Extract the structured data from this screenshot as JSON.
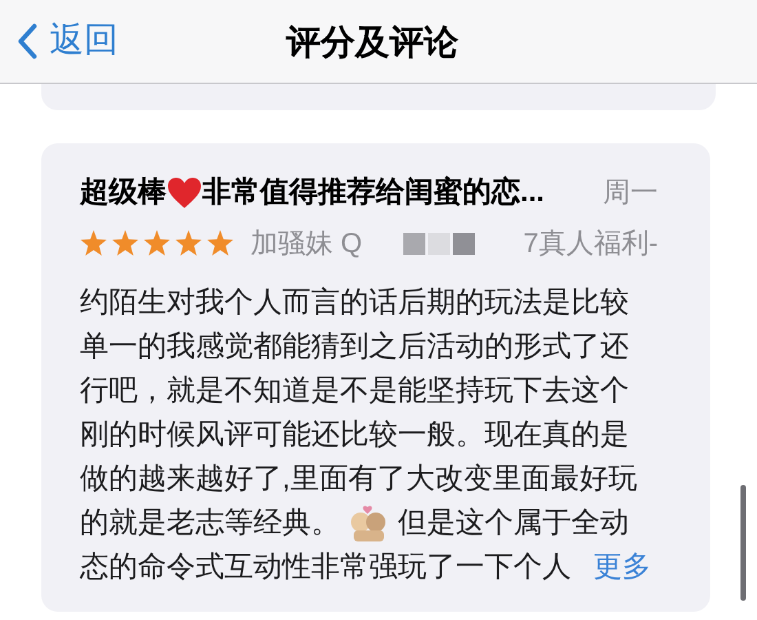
{
  "nav": {
    "back": "返回",
    "title": "评分及评论"
  },
  "review": {
    "title_before": "超级棒",
    "title_after": "非常值得推荐给闺蜜的恋...",
    "date": "周一",
    "stars": 5,
    "author_before": "加骚妹 Q",
    "author_after": "7真人福利-",
    "body_lines": [
      {
        "kind": "text",
        "text": "约陌生对我个人而言的话后期的玩法是比较"
      },
      {
        "kind": "text",
        "text": "单一的我感觉都能猜到之后活动的形式了还"
      },
      {
        "kind": "text",
        "text": "行吧，就是不知道是不是能坚持玩下去这个"
      },
      {
        "kind": "text",
        "text": "刚的时候风评可能还比较一般。现在真的是"
      },
      {
        "kind": "text",
        "text": "做的越来越好了,里面有了大改变里面最好玩"
      },
      {
        "kind": "emoji",
        "text": "的就是老志等经典。",
        "text_after": "但是这个属于全动"
      },
      {
        "kind": "more",
        "text": "态的命令式互动性非常强玩了一下个人",
        "more": "更多"
      }
    ]
  }
}
